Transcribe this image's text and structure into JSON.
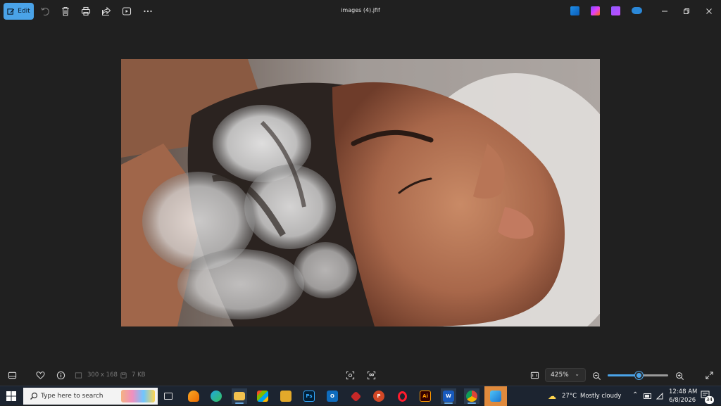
{
  "window": {
    "title": "images (4).jfif"
  },
  "toolbar": {
    "edit_label": "Edit",
    "icons": [
      "rotate-icon",
      "delete-icon",
      "print-icon",
      "share-icon",
      "slideshow-icon",
      "more-icon"
    ]
  },
  "app_icons": [
    "designer-icon",
    "clipchamp-icon",
    "create-video-icon",
    "onedrive-icon"
  ],
  "bottom": {
    "dimensions": "300 x 168",
    "file_size": "7 KB",
    "zoom": "425%",
    "zoom_fraction": 0.52
  },
  "taskbar": {
    "search_placeholder": "Type here to search",
    "apps": [
      {
        "name": "task-view",
        "label": ""
      },
      {
        "name": "fl-studio",
        "label": ""
      },
      {
        "name": "edge",
        "label": ""
      },
      {
        "name": "file-explorer",
        "label": ""
      },
      {
        "name": "microsoft-store",
        "label": ""
      },
      {
        "name": "photo-app",
        "label": ""
      },
      {
        "name": "photoshop",
        "label": "Ps"
      },
      {
        "name": "outlook",
        "label": "O"
      },
      {
        "name": "vpn",
        "label": ""
      },
      {
        "name": "powerpoint",
        "label": "P"
      },
      {
        "name": "opera",
        "label": "O"
      },
      {
        "name": "illustrator",
        "label": "Ai"
      },
      {
        "name": "word",
        "label": "W"
      },
      {
        "name": "chrome",
        "label": ""
      },
      {
        "name": "photos",
        "label": ""
      }
    ],
    "weather": {
      "temp": "27°C",
      "condition": "Mostly cloudy"
    },
    "clock": {
      "time": "12:48 AM",
      "date": "6/8/2026"
    },
    "notifications": "34"
  },
  "colors": {
    "accent": "#4aa3e8",
    "background": "#202020"
  }
}
